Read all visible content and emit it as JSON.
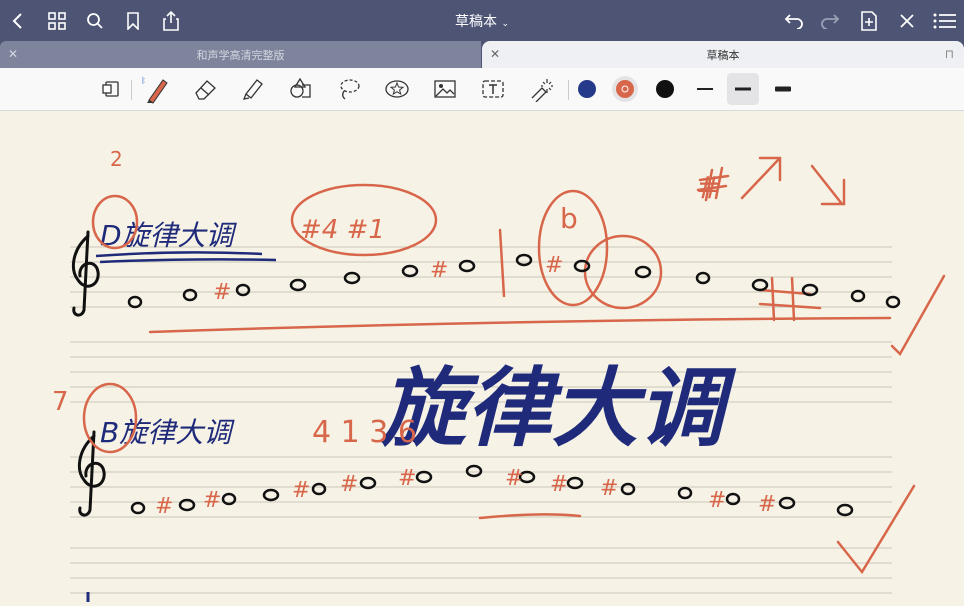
{
  "colors": {
    "topbar": "#4d5474",
    "paper": "#f6f3e6",
    "ink_blue": "#1f2b7a",
    "ink_red": "#d8664a",
    "ink_black": "#111111"
  },
  "topbar": {
    "title": "草稿本",
    "icons": [
      "back-icon",
      "grid-icon",
      "search-icon",
      "bookmark-icon",
      "share-icon",
      "undo-icon",
      "redo-icon",
      "add-page-icon",
      "close-icon",
      "more-icon"
    ]
  },
  "tabs": [
    {
      "label": "和声学高清完整版",
      "active": false
    },
    {
      "label": "草稿本",
      "active": true
    }
  ],
  "toolbar": {
    "tools": [
      "page-view",
      "pen",
      "eraser",
      "highlighter",
      "shapes",
      "lasso",
      "sticker",
      "image",
      "text",
      "laser-pointer"
    ],
    "colors": [
      "#253a8a",
      "#d8664a",
      "#111111"
    ],
    "selected_color": "#d8664a",
    "stroke_widths": [
      "thin",
      "medium",
      "thick"
    ],
    "selected_width": "medium"
  },
  "notes": {
    "heading1": "D旋律大调",
    "heading2": "B旋律大调",
    "big_title": "旋律大调",
    "annot_2": "2",
    "annot_7": "7",
    "annot_sharps": "#4 #1",
    "annot_b": "b",
    "annot_sharp": "#",
    "annot_nums": "4 1 3 6"
  }
}
